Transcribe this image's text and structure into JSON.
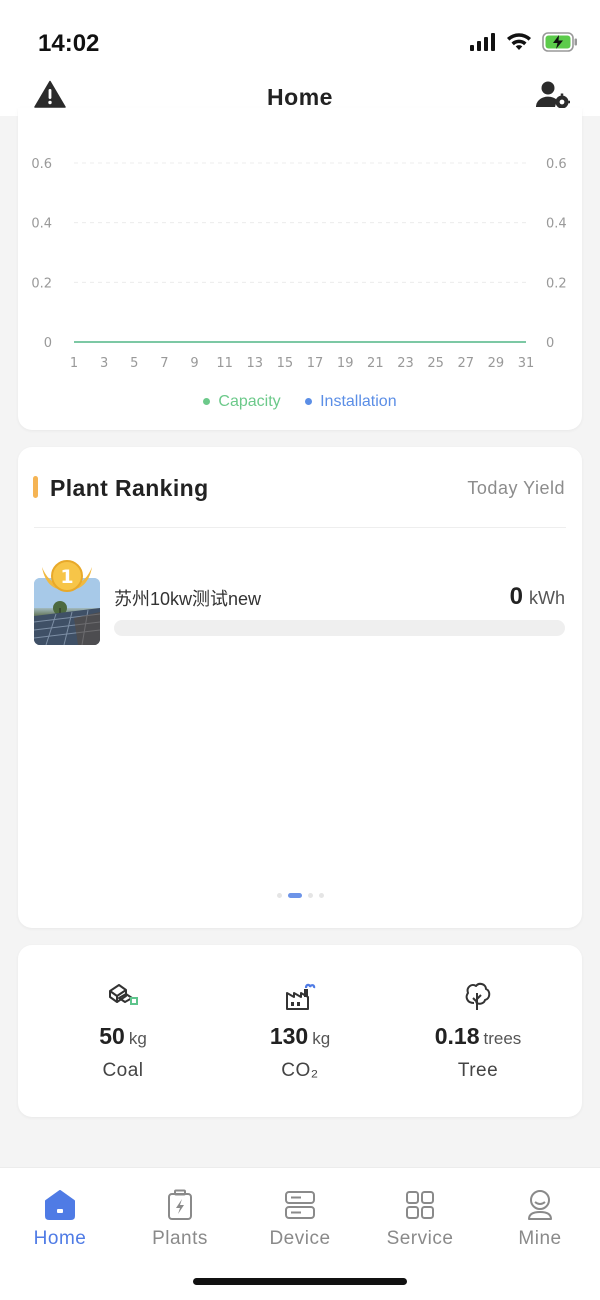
{
  "status_bar": {
    "time": "14:02",
    "icons": [
      "signal-icon",
      "wifi-icon",
      "battery-charging-icon"
    ]
  },
  "nav": {
    "title": "Home",
    "left_icon": "warning-icon",
    "right_icon": "user-settings-icon"
  },
  "chart_data": {
    "type": "line",
    "x": [
      1,
      2,
      3,
      4,
      5,
      6,
      7,
      8,
      9,
      10,
      11,
      12,
      13,
      14,
      15,
      16,
      17,
      18,
      19,
      20,
      21,
      22,
      23,
      24,
      25,
      26,
      27,
      28,
      29,
      30,
      31
    ],
    "x_tick_labels": [
      "1",
      "3",
      "5",
      "7",
      "9",
      "11",
      "13",
      "15",
      "17",
      "19",
      "21",
      "23",
      "25",
      "27",
      "29",
      "31"
    ],
    "y_tick_labels": [
      "0",
      "0.2",
      "0.4",
      "0.6"
    ],
    "ylim": [
      0,
      0.6
    ],
    "y2lim": [
      0,
      0.6
    ],
    "grid": true,
    "legend_position": "bottom",
    "series": [
      {
        "name": "Capacity",
        "color": "#6cc98a",
        "values": [
          0,
          0,
          0,
          0,
          0,
          0,
          0,
          0,
          0,
          0,
          0,
          0,
          0,
          0,
          0,
          0,
          0,
          0,
          0,
          0,
          0,
          0,
          0,
          0,
          0,
          0,
          0,
          0,
          0,
          0,
          0
        ]
      },
      {
        "name": "Installation",
        "color": "#5b8ee6",
        "values": [
          0,
          0,
          0,
          0,
          0,
          0,
          0,
          0,
          0,
          0,
          0,
          0,
          0,
          0,
          0,
          0,
          0,
          0,
          0,
          0,
          0,
          0,
          0,
          0,
          0,
          0,
          0,
          0,
          0,
          0,
          0
        ]
      }
    ]
  },
  "ranking": {
    "title": "Plant Ranking",
    "subtitle": "Today Yield",
    "accent_color": "#f5b454",
    "items": [
      {
        "rank": "1",
        "name": "苏州10kw测试new",
        "value": "0",
        "unit": "kWh",
        "progress": 0
      }
    ],
    "pager": {
      "count": 4,
      "active": 1
    }
  },
  "impact": [
    {
      "icon": "coal-icon",
      "value": "50",
      "unit": "kg",
      "label": "Coal"
    },
    {
      "icon": "co2-factory-icon",
      "value": "130",
      "unit": "kg",
      "label": "CO₂"
    },
    {
      "icon": "tree-icon",
      "value": "0.18",
      "unit": "trees",
      "label": "Tree"
    }
  ],
  "tabs": [
    {
      "label": "Home",
      "icon": "home-icon",
      "active": true
    },
    {
      "label": "Plants",
      "icon": "plants-icon",
      "active": false
    },
    {
      "label": "Device",
      "icon": "device-icon",
      "active": false
    },
    {
      "label": "Service",
      "icon": "service-icon",
      "active": false
    },
    {
      "label": "Mine",
      "icon": "mine-icon",
      "active": false
    }
  ],
  "colors": {
    "accent": "#4f7be5",
    "inactive": "#8a8a8a",
    "background": "#f4f4f4"
  }
}
